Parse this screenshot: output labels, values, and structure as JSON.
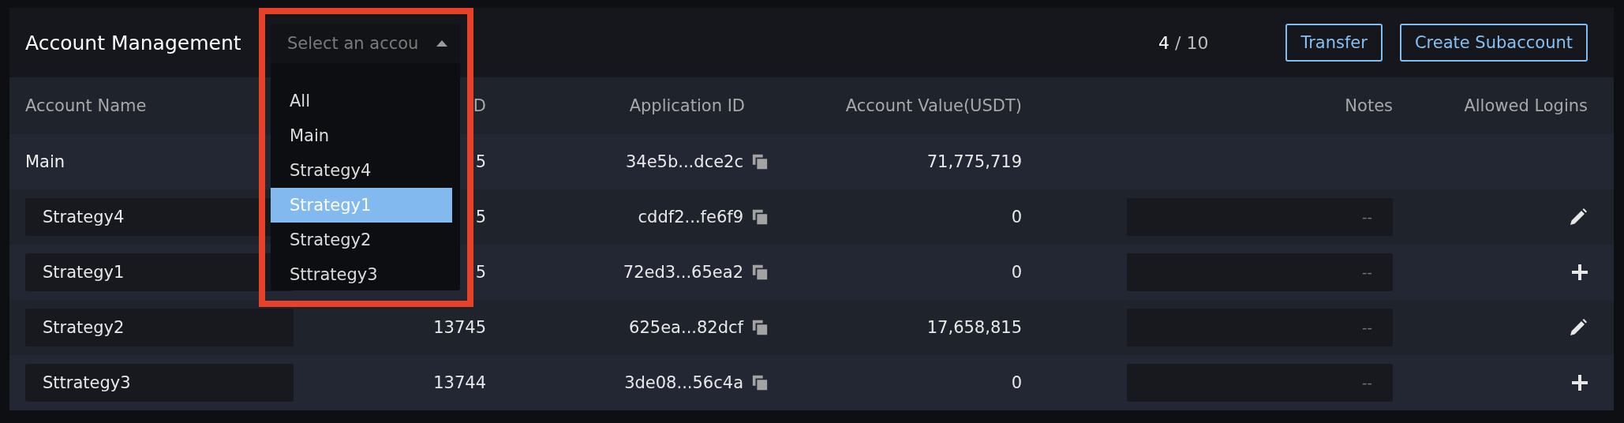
{
  "header": {
    "title": "Account Management",
    "select": {
      "placeholder": "Select an accou",
      "expanded": true
    },
    "count": {
      "current": "4",
      "separator": "/",
      "total": "10"
    },
    "buttons": [
      "Transfer",
      "Create Subaccount"
    ]
  },
  "dropdown": {
    "options": [
      {
        "label": "All",
        "selected": false
      },
      {
        "label": "Main",
        "selected": false
      },
      {
        "label": "Strategy4",
        "selected": false
      },
      {
        "label": "Strategy1",
        "selected": true
      },
      {
        "label": "Strategy2",
        "selected": false
      },
      {
        "label": "Sttrategy3",
        "selected": false
      }
    ]
  },
  "table": {
    "columns": [
      "Account Name",
      "D",
      "Application ID",
      "Account Value(USDT)",
      "Notes",
      "Allowed Logins"
    ],
    "rows": [
      {
        "kind": "main",
        "name": "Main",
        "column_2": "5",
        "application_id": "34e5b...dce2c",
        "account_value": "71,775,719"
      },
      {
        "kind": "sub",
        "name": "Strategy4",
        "column_2": "5",
        "application_id": "cddf2...fe6f9",
        "account_value": "0",
        "notes": "--",
        "logins_set": true
      },
      {
        "kind": "sub",
        "name": "Strategy1",
        "column_2": "5",
        "application_id": "72ed3...65ea2",
        "account_value": "0",
        "notes": "--",
        "logins_set": false
      },
      {
        "kind": "sub",
        "name": "Strategy2",
        "column_2": "13745",
        "application_id": "625ea...82dcf",
        "account_value": "17,658,815",
        "notes": "--",
        "logins_set": true
      },
      {
        "kind": "sub",
        "name": "Sttrategy3",
        "column_2": "13744",
        "application_id": "3de08...56c4a",
        "account_value": "0",
        "notes": "--",
        "logins_set": false
      }
    ]
  }
}
